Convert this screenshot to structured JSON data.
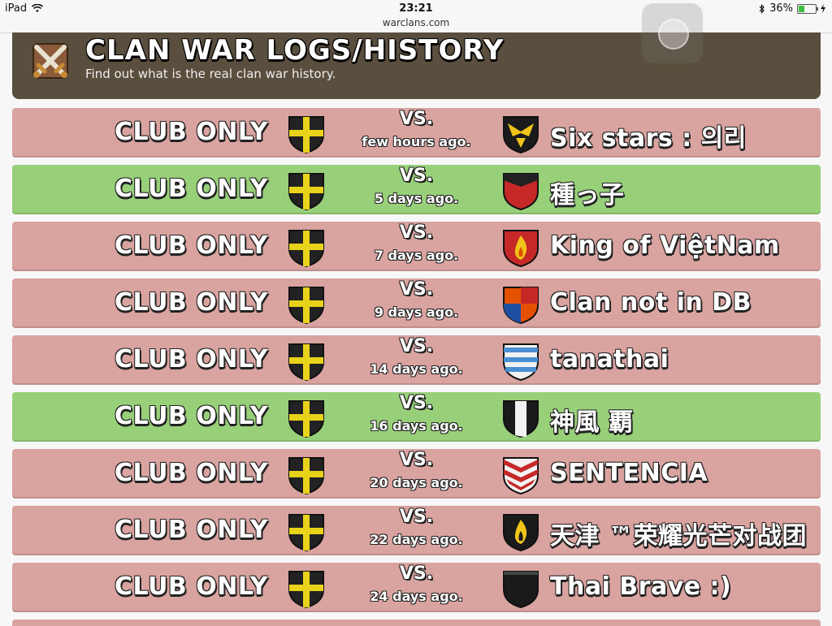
{
  "status_bar": {
    "device": "iPad",
    "time": "23:21",
    "url": "warclans.com",
    "battery": "36%",
    "battery_level": 0.36,
    "icons": [
      "wifi-icon",
      "bluetooth-icon",
      "battery-icon",
      "charging-icon"
    ]
  },
  "header": {
    "title": "CLAN WAR LOGS/HISTORY",
    "subtitle": "Find out what is the real clan war history.",
    "icon": "crossed-swords-icon",
    "background": "#5a4e3e"
  },
  "colors": {
    "loss": "#d9a3a0",
    "win": "#98d07a"
  },
  "wars": [
    {
      "result": "loss",
      "clan": "CLUB ONLY",
      "vs": "VS.",
      "time": "few hours ago.",
      "opponent": "Six stars : 의리",
      "opponent_badge": "eagle-badge-icon"
    },
    {
      "result": "win",
      "clan": "CLUB ONLY",
      "vs": "VS.",
      "time": "5 days ago.",
      "opponent": "種っ子",
      "opponent_badge": "red-chevron-badge-icon"
    },
    {
      "result": "loss",
      "clan": "CLUB ONLY",
      "vs": "VS.",
      "time": "7 days ago.",
      "opponent": "King of ViệtNam",
      "opponent_badge": "red-flame-badge-icon"
    },
    {
      "result": "loss",
      "clan": "CLUB ONLY",
      "vs": "VS.",
      "time": "9 days ago.",
      "opponent": "Clan not in DB",
      "opponent_badge": "quartered-badge-icon"
    },
    {
      "result": "loss",
      "clan": "CLUB ONLY",
      "vs": "VS.",
      "time": "14 days ago.",
      "opponent": "tanathai",
      "opponent_badge": "blue-stripes-badge-icon"
    },
    {
      "result": "win",
      "clan": "CLUB ONLY",
      "vs": "VS.",
      "time": "16 days ago.",
      "opponent": "神風 覇",
      "opponent_badge": "black-white-badge-icon"
    },
    {
      "result": "loss",
      "clan": "CLUB ONLY",
      "vs": "VS.",
      "time": "20 days ago.",
      "opponent": "SENTENCIA",
      "opponent_badge": "red-chevrons-badge-icon"
    },
    {
      "result": "loss",
      "clan": "CLUB ONLY",
      "vs": "VS.",
      "time": "22 days ago.",
      "opponent": "天津 ™荣耀光芒对战团",
      "opponent_badge": "yellow-flame-badge-icon"
    },
    {
      "result": "loss",
      "clan": "CLUB ONLY",
      "vs": "VS.",
      "time": "24 days ago.",
      "opponent": "Thai Brave :)",
      "opponent_badge": "black-badge-icon"
    }
  ]
}
